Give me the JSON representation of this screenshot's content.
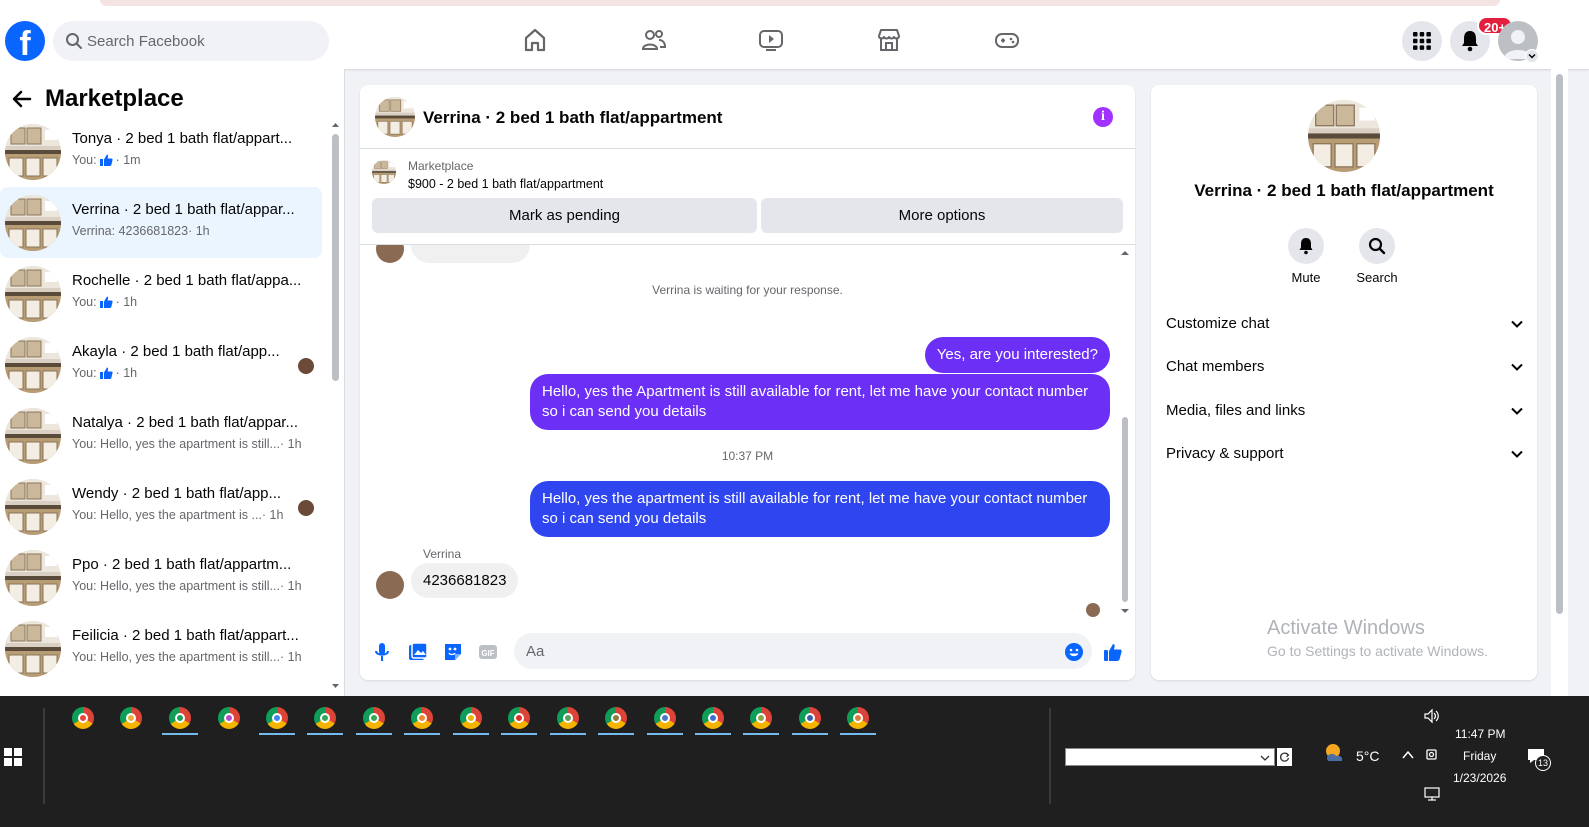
{
  "header": {
    "search_placeholder": "Search Facebook",
    "notifications_badge": "20+",
    "icons": [
      "home-icon",
      "friends-icon",
      "video-icon",
      "marketplace-icon",
      "gaming-icon",
      "menu-grid-icon",
      "bell-icon",
      "account-avatar"
    ]
  },
  "sidebar": {
    "title": "Marketplace",
    "conversations": [
      {
        "name": "Tonya · 2 bed 1 bath flat/appart...",
        "sub_prefix": "You:",
        "sub_like": true,
        "sub_text": "",
        "time": "· 1m",
        "active": false,
        "avatar_dot": false
      },
      {
        "name": "Verrina · 2 bed 1 bath flat/appar...",
        "sub_prefix": "Verrina: 4236681823",
        "sub_like": false,
        "sub_text": "",
        "time": "· 1h",
        "active": true,
        "avatar_dot": false
      },
      {
        "name": "Rochelle · 2 bed 1 bath flat/appa...",
        "sub_prefix": "You:",
        "sub_like": true,
        "sub_text": "",
        "time": "· 1h",
        "active": false,
        "avatar_dot": false
      },
      {
        "name": "Akayla · 2 bed 1 bath flat/app...",
        "sub_prefix": "You:",
        "sub_like": true,
        "sub_text": "",
        "time": "· 1h",
        "active": false,
        "avatar_dot": true
      },
      {
        "name": "Natalya · 2 bed 1 bath flat/appar...",
        "sub_prefix": "You: Hello, yes the apartment is still...",
        "sub_like": false,
        "sub_text": "",
        "time": "· 1h",
        "active": false,
        "avatar_dot": false
      },
      {
        "name": "Wendy · 2 bed 1 bath flat/app...",
        "sub_prefix": "You: Hello, yes the apartment is ...",
        "sub_like": false,
        "sub_text": "",
        "time": "· 1h",
        "active": false,
        "avatar_dot": true
      },
      {
        "name": "Ppo · 2 bed 1 bath flat/appartm...",
        "sub_prefix": "You: Hello, yes the apartment is still...",
        "sub_like": false,
        "sub_text": "",
        "time": "· 1h",
        "active": false,
        "avatar_dot": false
      },
      {
        "name": "Feilicia · 2 bed 1 bath flat/appart...",
        "sub_prefix": "You: Hello, yes the apartment is still...",
        "sub_like": false,
        "sub_text": "",
        "time": "· 1h",
        "active": false,
        "avatar_dot": false
      }
    ]
  },
  "chat": {
    "title": "Verrina · 2 bed 1 bath flat/appartment",
    "listing_source": "Marketplace",
    "listing_price": "$900 - 2 bed 1 bath flat/appartment",
    "mark_pending": "Mark as pending",
    "more_options": "More options",
    "waiting_text": "Verrina is waiting for your response.",
    "msg_1": "Yes, are you interested?",
    "msg_2": "Hello, yes the Apartment is still available for rent, let me have your contact number so i can send you details",
    "timestamp": "10:37 PM",
    "msg_3": "Hello, yes the apartment is still available for rent, let me have your contact number so i can send you details",
    "sender": "Verrina",
    "msg_4": "4236681823",
    "composer_placeholder": "Aa"
  },
  "details": {
    "name": "Verrina · 2 bed 1 bath flat/appartment",
    "mute": "Mute",
    "search": "Search",
    "rows": [
      "Customize chat",
      "Chat members",
      "Media, files and links",
      "Privacy & support"
    ],
    "watermark_1": "Activate Windows",
    "watermark_2": "Go to Settings to activate Windows."
  },
  "taskbar": {
    "weather": "5°C",
    "time": "11:47 PM",
    "day": "Friday",
    "date": "1/23/2026",
    "notifications_count": "13"
  }
}
